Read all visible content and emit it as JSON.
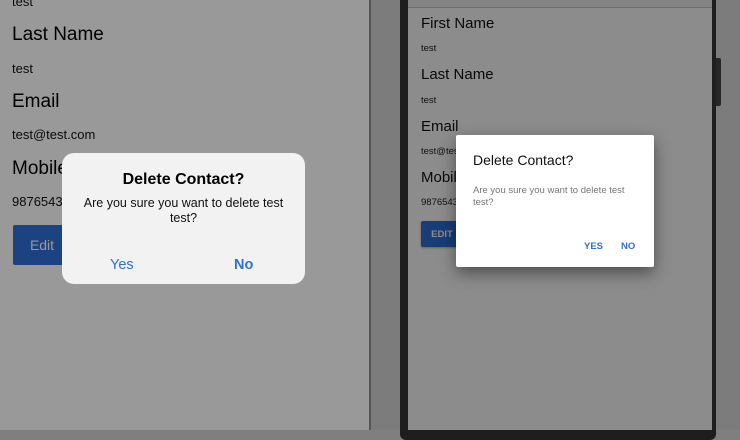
{
  "ios": {
    "top_value": "test",
    "fields": [
      {
        "label": "Last Name",
        "value": "test"
      },
      {
        "label": "Email",
        "value": "test@test.com"
      },
      {
        "label": "Mobile",
        "value": "9876543210"
      }
    ],
    "edit_label": "Edit",
    "alert": {
      "title": "Delete Contact?",
      "message": "Are you sure you want to delete test test?",
      "yes_label": "Yes",
      "no_label": "No"
    }
  },
  "android": {
    "fields": [
      {
        "label": "First Name",
        "value": "test"
      },
      {
        "label": "Last Name",
        "value": "test"
      },
      {
        "label": "Email",
        "value": "test@test.com"
      },
      {
        "label": "Mobile",
        "value": "9876543210"
      }
    ],
    "edit_label": "EDIT",
    "dialog": {
      "title": "Delete Contact?",
      "message": "Are you sure you want to delete test test?",
      "yes_label": "YES",
      "no_label": "NO"
    }
  }
}
